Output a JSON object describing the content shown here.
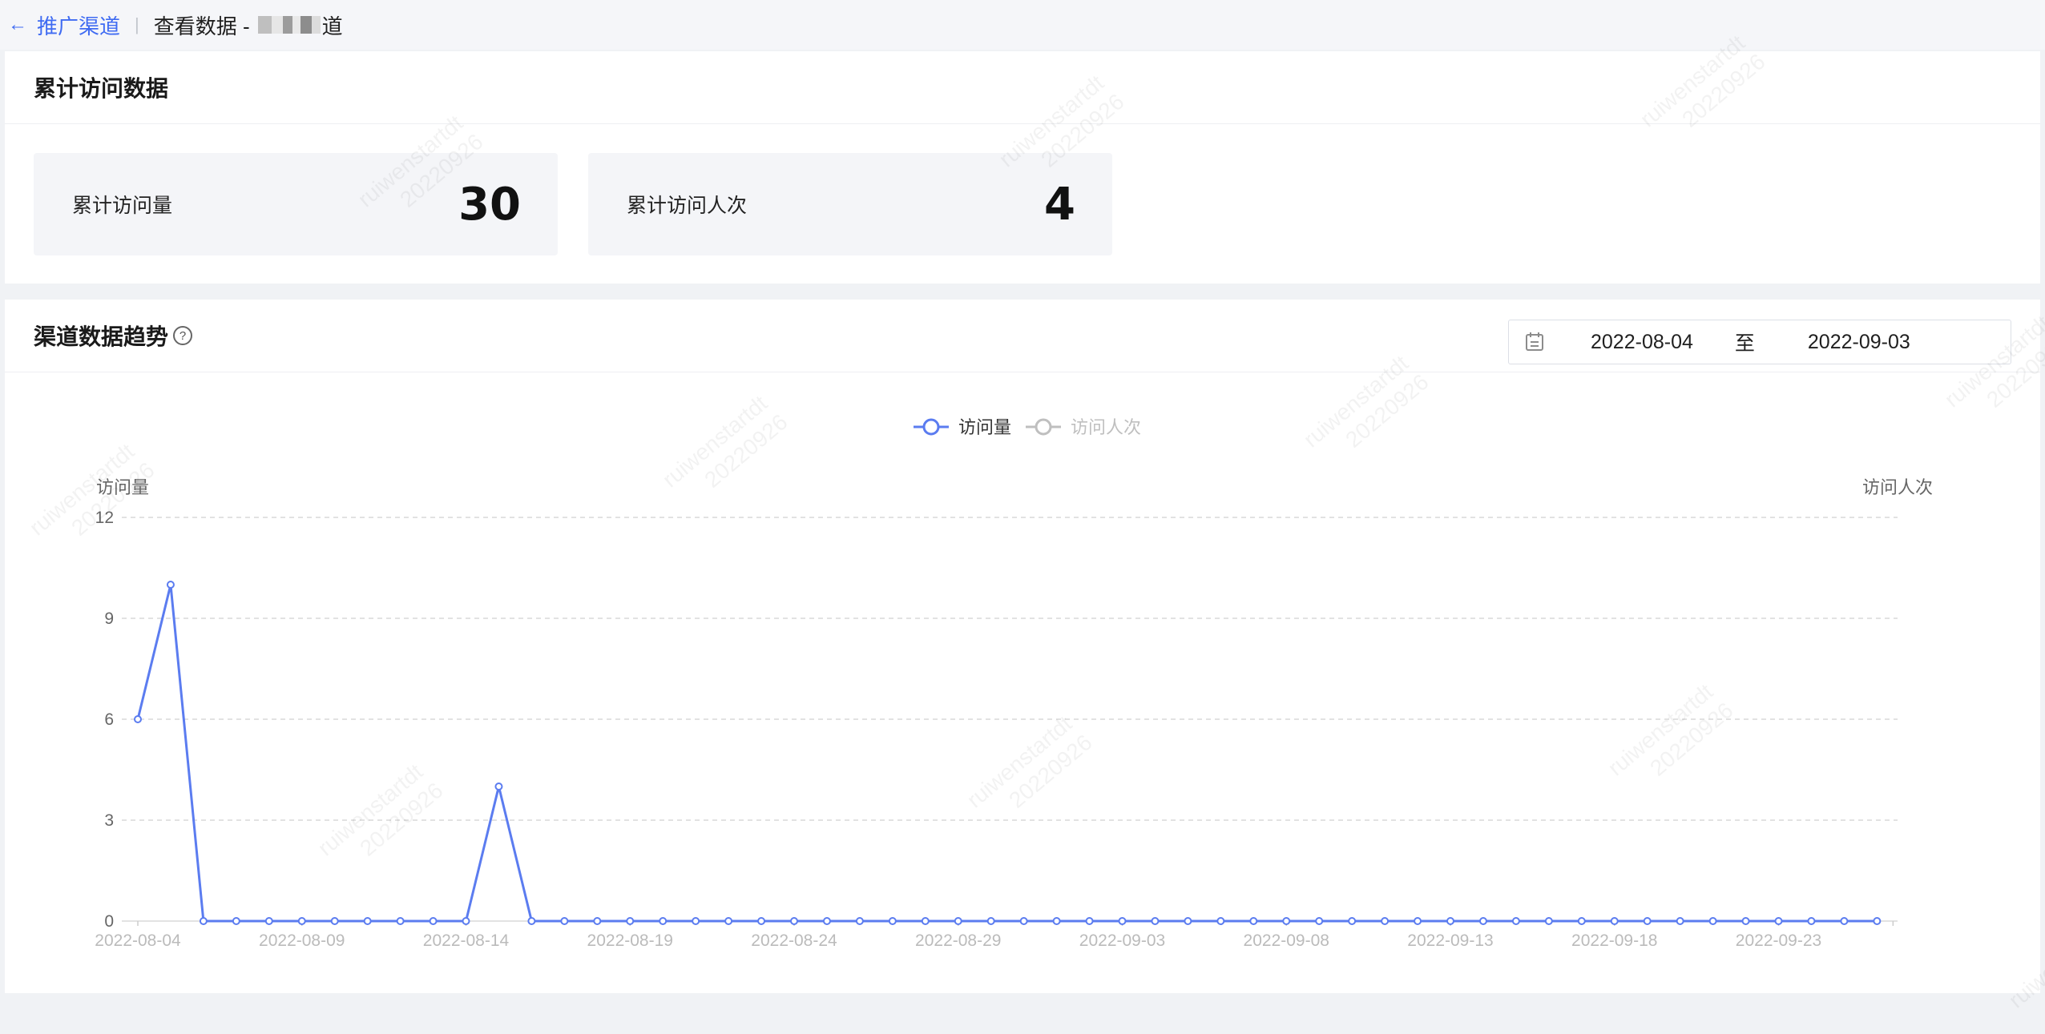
{
  "breadcrumb": {
    "back_label": "推广渠道",
    "separator": "|",
    "title_prefix": "查看数据 - ",
    "title_suffix": "道"
  },
  "summary": {
    "title": "累计访问数据",
    "cards": [
      {
        "label": "累计访问量",
        "value": "30"
      },
      {
        "label": "累计访问人次",
        "value": "4"
      }
    ]
  },
  "trend": {
    "title": "渠道数据趋势",
    "help_icon": "question-circle-icon",
    "date_range": {
      "start": "2022-08-04",
      "separator": "至",
      "end": "2022-09-03",
      "icon": "calendar-icon"
    }
  },
  "watermark": {
    "user": "ruiwenstartdt",
    "date": "20220926"
  },
  "colors": {
    "accent": "#3f6bf2",
    "series_line": "#5b7cf0",
    "series_inactive": "#bfbfbf",
    "grid": "#d9d9d9"
  },
  "chart_data": {
    "type": "line",
    "legend": [
      {
        "name": "访问量",
        "active": true
      },
      {
        "name": "访问人次",
        "active": false
      }
    ],
    "legend_position": "top-center",
    "ylabel_left": "访问量",
    "ylabel_right": "访问人次",
    "ylim": [
      0,
      12
    ],
    "yticks": [
      0,
      3,
      6,
      9,
      12
    ],
    "x_tick_labels": [
      "2022-08-04",
      "2022-08-09",
      "2022-08-14",
      "2022-08-19",
      "2022-08-24",
      "2022-08-29",
      "2022-09-03",
      "2022-09-08",
      "2022-09-13",
      "2022-09-18",
      "2022-09-23"
    ],
    "x": [
      "2022-08-04",
      "2022-08-05",
      "2022-08-06",
      "2022-08-07",
      "2022-08-08",
      "2022-08-09",
      "2022-08-10",
      "2022-08-11",
      "2022-08-12",
      "2022-08-13",
      "2022-08-14",
      "2022-08-15",
      "2022-08-16",
      "2022-08-17",
      "2022-08-18",
      "2022-08-19",
      "2022-08-20",
      "2022-08-21",
      "2022-08-22",
      "2022-08-23",
      "2022-08-24",
      "2022-08-25",
      "2022-08-26",
      "2022-08-27",
      "2022-08-28",
      "2022-08-29",
      "2022-08-30",
      "2022-08-31",
      "2022-09-01",
      "2022-09-02",
      "2022-09-03",
      "2022-09-04",
      "2022-09-05",
      "2022-09-06",
      "2022-09-07",
      "2022-09-08",
      "2022-09-09",
      "2022-09-10",
      "2022-09-11",
      "2022-09-12",
      "2022-09-13",
      "2022-09-14",
      "2022-09-15",
      "2022-09-16",
      "2022-09-17",
      "2022-09-18",
      "2022-09-19",
      "2022-09-20",
      "2022-09-21",
      "2022-09-22",
      "2022-09-23",
      "2022-09-24",
      "2022-09-25",
      "2022-09-26"
    ],
    "series": [
      {
        "name": "访问量",
        "values": [
          6,
          10,
          0,
          0,
          0,
          0,
          0,
          0,
          0,
          0,
          0,
          4,
          0,
          0,
          0,
          0,
          0,
          0,
          0,
          0,
          0,
          0,
          0,
          0,
          0,
          0,
          0,
          0,
          0,
          0,
          0,
          0,
          0,
          0,
          0,
          0,
          0,
          0,
          0,
          0,
          0,
          0,
          0,
          0,
          0,
          0,
          0,
          0,
          0,
          0,
          0,
          0,
          0,
          0
        ]
      }
    ],
    "grid": true
  }
}
